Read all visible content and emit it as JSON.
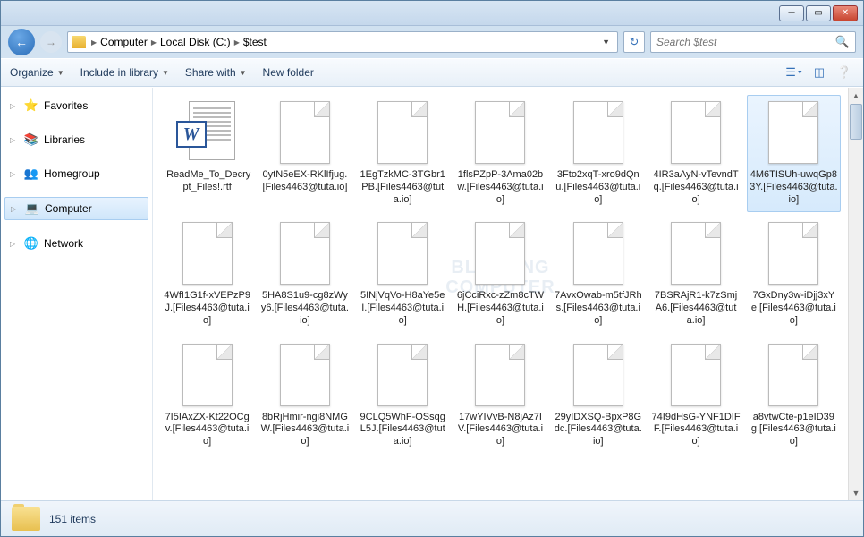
{
  "breadcrumb": {
    "root": "Computer",
    "drive": "Local Disk (C:)",
    "folder": "$test"
  },
  "search": {
    "placeholder": "Search $test"
  },
  "toolbar": {
    "organize": "Organize",
    "include": "Include in library",
    "share": "Share with",
    "newfolder": "New folder"
  },
  "sidebar": {
    "favorites": "Favorites",
    "libraries": "Libraries",
    "homegroup": "Homegroup",
    "computer": "Computer",
    "network": "Network"
  },
  "watermark_line1": "BLEEPING",
  "watermark_line2": "COMPUTER",
  "files": [
    {
      "name": "!ReadMe_To_Decrypt_Files!.rtf",
      "type": "word",
      "selected": false
    },
    {
      "name": "0ytN5eEX-RKlIfjug.[Files4463@tuta.io]",
      "type": "generic",
      "selected": false
    },
    {
      "name": "1EgTzkMC-3TGbr1PB.[Files4463@tuta.io]",
      "type": "generic",
      "selected": false
    },
    {
      "name": "1flsPZpP-3Ama02bw.[Files4463@tuta.io]",
      "type": "generic",
      "selected": false
    },
    {
      "name": "3Fto2xqT-xro9dQnu.[Files4463@tuta.io]",
      "type": "generic",
      "selected": false
    },
    {
      "name": "4IR3aAyN-vTevndTq.[Files4463@tuta.io]",
      "type": "generic",
      "selected": false
    },
    {
      "name": "4M6TISUh-uwqGp83Y.[Files4463@tuta.io]",
      "type": "generic",
      "selected": true
    },
    {
      "name": "4WfI1G1f-xVEPzP9J.[Files4463@tuta.io]",
      "type": "generic",
      "selected": false
    },
    {
      "name": "5HA8S1u9-cg8zWyy6.[Files4463@tuta.io]",
      "type": "generic",
      "selected": false
    },
    {
      "name": "5INjVqVo-H8aYe5eI.[Files4463@tuta.io]",
      "type": "generic",
      "selected": false
    },
    {
      "name": "6jCciRxc-zZm8cTWH.[Files4463@tuta.io]",
      "type": "generic",
      "selected": false
    },
    {
      "name": "7AvxOwab-m5tfJRhs.[Files4463@tuta.io]",
      "type": "generic",
      "selected": false
    },
    {
      "name": "7BSRAjR1-k7zSmjA6.[Files4463@tuta.io]",
      "type": "generic",
      "selected": false
    },
    {
      "name": "7GxDny3w-iDjj3xYe.[Files4463@tuta.io]",
      "type": "generic",
      "selected": false
    },
    {
      "name": "7I5IAxZX-Kt22OCgv.[Files4463@tuta.io]",
      "type": "generic",
      "selected": false
    },
    {
      "name": "8bRjHmir-ngi8NMGW.[Files4463@tuta.io]",
      "type": "generic",
      "selected": false
    },
    {
      "name": "9CLQ5WhF-OSsqgL5J.[Files4463@tuta.io]",
      "type": "generic",
      "selected": false
    },
    {
      "name": "17wYIVvB-N8jAz7IV.[Files4463@tuta.io]",
      "type": "generic",
      "selected": false
    },
    {
      "name": "29yIDXSQ-BpxP8Gdc.[Files4463@tuta.io]",
      "type": "generic",
      "selected": false
    },
    {
      "name": "74I9dHsG-YNF1DIFF.[Files4463@tuta.io]",
      "type": "generic",
      "selected": false
    },
    {
      "name": "a8vtwCte-p1eID39g.[Files4463@tuta.io]",
      "type": "generic",
      "selected": false
    }
  ],
  "status": {
    "count": "151 items"
  }
}
